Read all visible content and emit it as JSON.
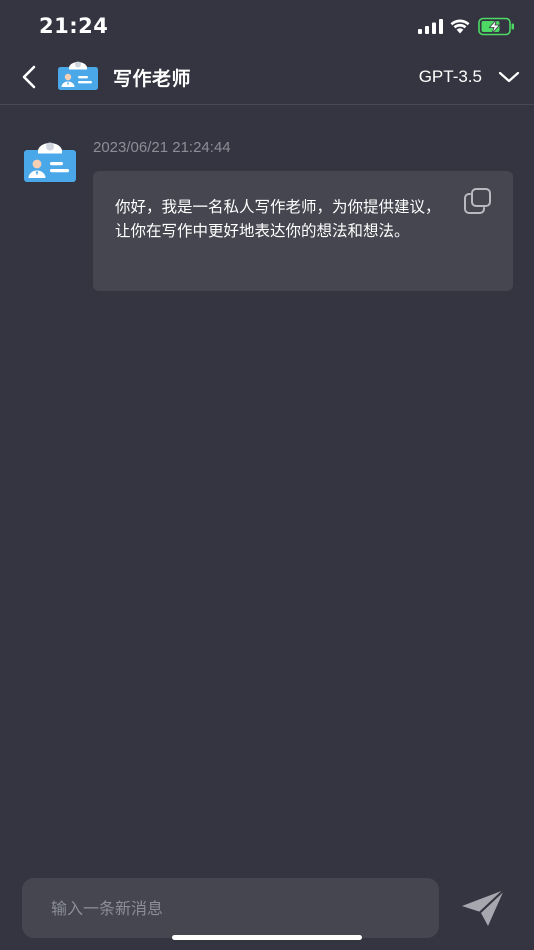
{
  "status_bar": {
    "time": "21:24",
    "icons": [
      "cellular-signal-icon",
      "wifi-icon",
      "battery-charging-icon"
    ]
  },
  "nav": {
    "back_icon": "chevron-left-icon",
    "title": "写作老师",
    "model": "GPT-3.5",
    "model_dropdown_icon": "chevron-down-icon"
  },
  "messages": [
    {
      "sender_icon": "teacher-badge-icon",
      "timestamp": "2023/06/21 21:24:44",
      "text": "你好，我是一名私人写作老师，为你提供建议，让你在写作中更好地表达你的想法和想法。",
      "copy_icon": "copy-icon"
    }
  ],
  "input": {
    "placeholder": "输入一条新消息",
    "value": "",
    "send_icon": "send-icon"
  },
  "colors": {
    "background": "#343540",
    "bubble": "#45464f",
    "muted_text": "#8c8d97",
    "avatar_blue": "#4ba8e8",
    "battery_green": "#4cd964"
  }
}
